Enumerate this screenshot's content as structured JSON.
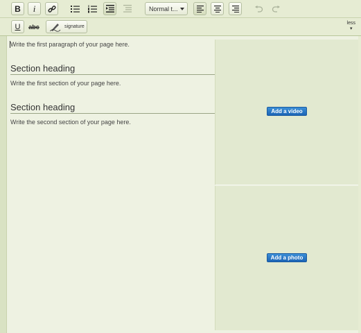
{
  "toolbar1": {
    "bold_label": "B",
    "italic_label": "i",
    "paragraph_style": "Normal t...",
    "icons": [
      "bold-icon",
      "italic-icon",
      "link-icon",
      "bulleted-list-icon",
      "numbered-list-icon",
      "indent-icon",
      "outdent-icon",
      "align-left-icon",
      "align-center-icon",
      "align-right-icon",
      "undo-icon",
      "redo-icon"
    ]
  },
  "toolbar2": {
    "underline_label": "U",
    "strike_label": "abc",
    "signature_label": "signature",
    "less_label": "less"
  },
  "editor": {
    "intro": "Write the first paragraph of your page here.",
    "section1_heading": "Section heading",
    "section1_text": "Write the first section of your page here.",
    "section2_heading": "Section heading",
    "section2_text": "Write the second section of your page here."
  },
  "side": {
    "video_button": "Add a video",
    "photo_button": "Add a photo"
  },
  "colors": {
    "toolbar_bg": "#e6ecd3",
    "editor_bg": "#eef2e2",
    "side_panel_bg": "#e2e9d0",
    "button_blue": "#1c64b5"
  }
}
